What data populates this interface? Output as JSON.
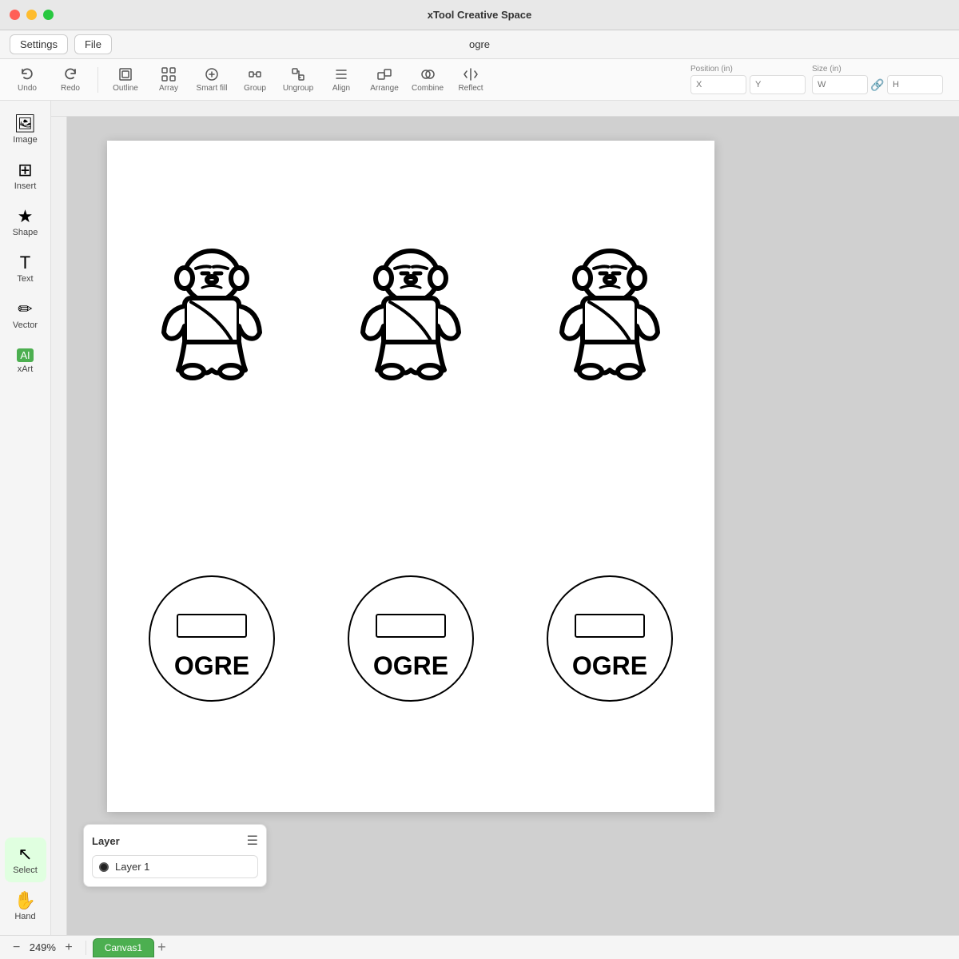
{
  "app": {
    "title": "xTool Creative Space",
    "window_title": "ogre"
  },
  "titlebar": {
    "close": "close",
    "minimize": "minimize",
    "maximize": "maximize"
  },
  "menubar": {
    "settings_label": "Settings",
    "file_label": "File",
    "doc_title": "ogre"
  },
  "toolbar": {
    "undo_label": "Undo",
    "redo_label": "Redo",
    "outline_label": "Outline",
    "array_label": "Array",
    "smart_fill_label": "Smart fill",
    "group_label": "Group",
    "ungroup_label": "Ungroup",
    "align_label": "Align",
    "arrange_label": "Arrange",
    "combine_label": "Combine",
    "reflect_label": "Reflect",
    "position_label": "Position (in)",
    "size_label": "Size (in)",
    "x_placeholder": "X",
    "y_placeholder": "Y",
    "w_placeholder": "W",
    "h_placeholder": "H"
  },
  "sidebar": {
    "image_label": "Image",
    "insert_label": "Insert",
    "shape_label": "Shape",
    "text_label": "Text",
    "vector_label": "Vector",
    "xart_label": "xArt",
    "select_label": "Select",
    "hand_label": "Hand"
  },
  "canvas": {
    "ogre_text": "OGRE",
    "zoom_value": "249%",
    "canvas_tab": "Canvas1"
  },
  "layer_panel": {
    "title": "Layer",
    "layer1_name": "Layer 1"
  }
}
